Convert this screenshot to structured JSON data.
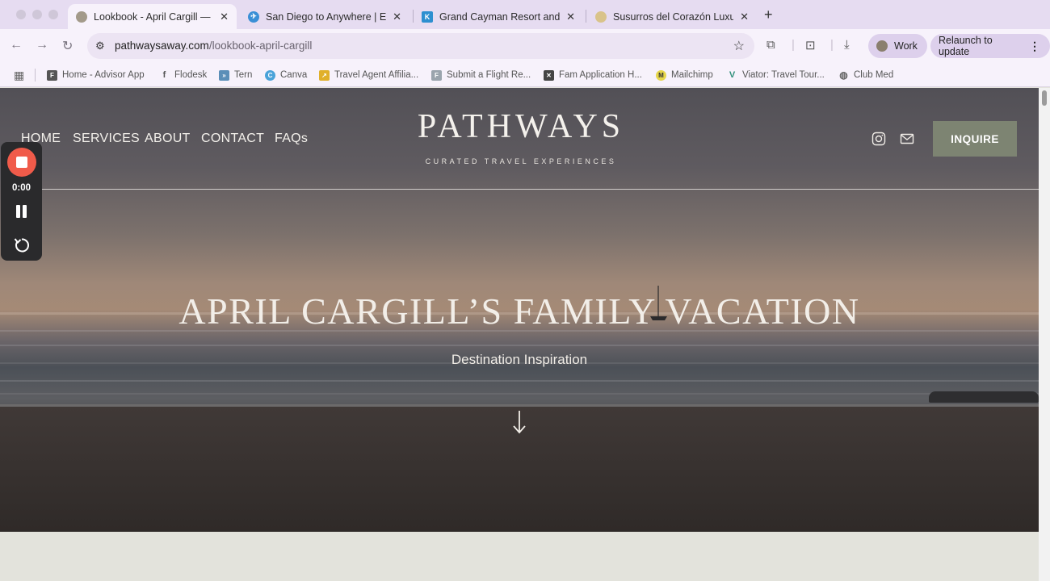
{
  "browser": {
    "tabs": [
      {
        "title": "Lookbook - April Cargill — Pat",
        "favicon_color": "#a39a8a",
        "active": true
      },
      {
        "title": "San Diego to Anywhere | Expl",
        "favicon_color": "#3a8fd6",
        "active": false
      },
      {
        "title": "Grand Cayman Resort and Sp",
        "favicon_color": "#2d8fd0",
        "favicon_letter": "K",
        "active": false
      },
      {
        "title": "Susurros del Corazón Luxury",
        "favicon_color": "#d9c38a",
        "active": false
      }
    ],
    "url_domain": "pathwaysaway.com",
    "url_path": "/lookbook-april-cargill",
    "profile_label": "Work",
    "relaunch_label": "Relaunch to update",
    "bookmarks": [
      {
        "label": "Home - Advisor App",
        "icon_letter": "F",
        "icon_color": "#555555"
      },
      {
        "label": "Flodesk",
        "icon_letter": "f",
        "icon_color": "#777777"
      },
      {
        "label": "Tern",
        "icon_letter": "»",
        "icon_color": "#5b8fb8"
      },
      {
        "label": "Canva",
        "icon_letter": "C",
        "icon_color": "#4aa3d9"
      },
      {
        "label": "Travel Agent Affilia...",
        "icon_letter": "↗",
        "icon_color": "#e0b02a"
      },
      {
        "label": "Submit a Flight Re...",
        "icon_letter": "F",
        "icon_color": "#9aa4ad"
      },
      {
        "label": "Fam Application H...",
        "icon_letter": "✕",
        "icon_color": "#444444"
      },
      {
        "label": "Mailchimp",
        "icon_letter": "M",
        "icon_color": "#e6d64a"
      },
      {
        "label": "Viator: Travel Tour...",
        "icon_letter": "V",
        "icon_color": "#2f8f7a"
      },
      {
        "label": "Club Med",
        "icon_letter": "◍",
        "icon_color": "#777777"
      }
    ]
  },
  "site": {
    "nav": [
      "HOME",
      "SERVICES",
      "ABOUT",
      "CONTACT",
      "FAQs"
    ],
    "logo": "PATHWAYS",
    "tagline": "CURATED TRAVEL EXPERIENCES",
    "inquire_label": "INQUIRE",
    "hero_title": "APRIL CARGILL’S FAMILY VACATION",
    "hero_subtitle": "Destination Inspiration",
    "icons": [
      "instagram-icon",
      "mail-icon",
      "down-arrow-icon"
    ]
  },
  "recorder": {
    "time": "0:00",
    "colors": {
      "stop": "#f05b4a",
      "panel": "#2a2a2c"
    }
  }
}
